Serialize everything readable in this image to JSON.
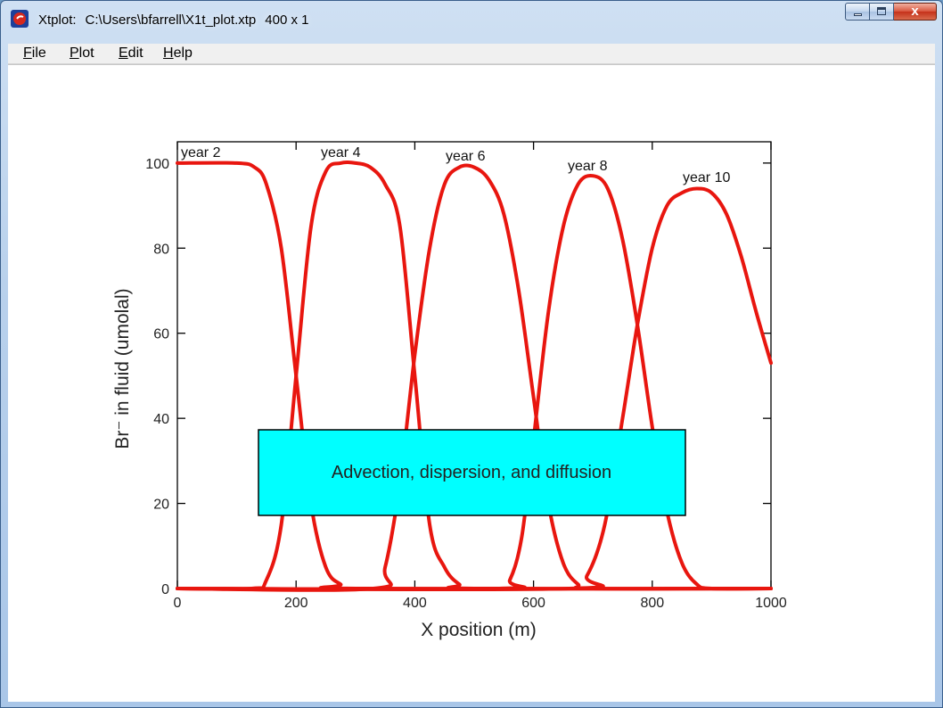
{
  "window": {
    "app_name": "Xtplot:",
    "file_path": "C:\\Users\\bfarrell\\X1t_plot.xtp",
    "dims": "400 x 1",
    "close_glyph": "x"
  },
  "icons": {
    "app": "xtplot-app-icon",
    "minimize": "minimize-icon",
    "maximize": "maximize-icon",
    "close": "close-icon"
  },
  "menu": {
    "file": {
      "first": "F",
      "rest": "ile"
    },
    "plot": {
      "first": "P",
      "rest": "lot"
    },
    "edit": {
      "first": "E",
      "rest": "dit"
    },
    "help": {
      "first": "H",
      "rest": "elp"
    }
  },
  "chart_data": {
    "type": "line",
    "xlabel": "X position (m)",
    "ylabel": "Br⁻ in fluid (umolal)",
    "xlim": [
      0,
      1000
    ],
    "ylim": [
      0,
      105
    ],
    "xticks": [
      0,
      200,
      400,
      600,
      800,
      1000
    ],
    "yticks": [
      0,
      20,
      40,
      60,
      80,
      100
    ],
    "line_color": "#e8160f",
    "annotation": "Advection, dispersion, and diffusion",
    "annotation_fill": "#00ffff",
    "series": [
      {
        "name": "year 2",
        "x": [
          0,
          100,
          130,
          150,
          175,
          200,
          225,
          250,
          275,
          300,
          1000
        ],
        "y": [
          100,
          100,
          99,
          95,
          80,
          50,
          20,
          5,
          1,
          0,
          0
        ]
      },
      {
        "name": "year 4",
        "x": [
          0,
          125,
          150,
          175,
          200,
          225,
          250,
          275,
          300,
          325,
          350,
          375,
          400,
          425,
          450,
          475,
          500,
          1000
        ],
        "y": [
          0,
          0,
          2,
          15,
          50,
          85,
          98,
          100,
          100,
          99,
          95,
          85,
          50,
          15,
          5,
          1,
          0,
          0
        ]
      },
      {
        "name": "year 6",
        "x": [
          0,
          330,
          350,
          375,
          400,
          425,
          450,
          475,
          500,
          525,
          550,
          575,
          600,
          625,
          650,
          675,
          700,
          1000
        ],
        "y": [
          0,
          0,
          5,
          25,
          55,
          80,
          95,
          99,
          99,
          96,
          88,
          70,
          45,
          20,
          6,
          1,
          0,
          0
        ]
      },
      {
        "name": "year 8",
        "x": [
          0,
          540,
          560,
          580,
          600,
          625,
          650,
          675,
          700,
          725,
          750,
          775,
          800,
          825,
          850,
          875,
          900,
          1000
        ],
        "y": [
          0,
          0,
          2,
          12,
          35,
          65,
          85,
          95,
          97,
          94,
          82,
          62,
          38,
          18,
          6,
          1,
          0,
          0
        ]
      },
      {
        "name": "year 10",
        "x": [
          0,
          660,
          690,
          720,
          750,
          775,
          800,
          825,
          850,
          875,
          900,
          925,
          950,
          975,
          1000
        ],
        "y": [
          0,
          0,
          3,
          15,
          40,
          62,
          80,
          90,
          93,
          94,
          93,
          88,
          78,
          65,
          53
        ]
      }
    ],
    "series_labels": [
      "year 2",
      "year 4",
      "year 6",
      "year 8",
      "year 10"
    ]
  }
}
